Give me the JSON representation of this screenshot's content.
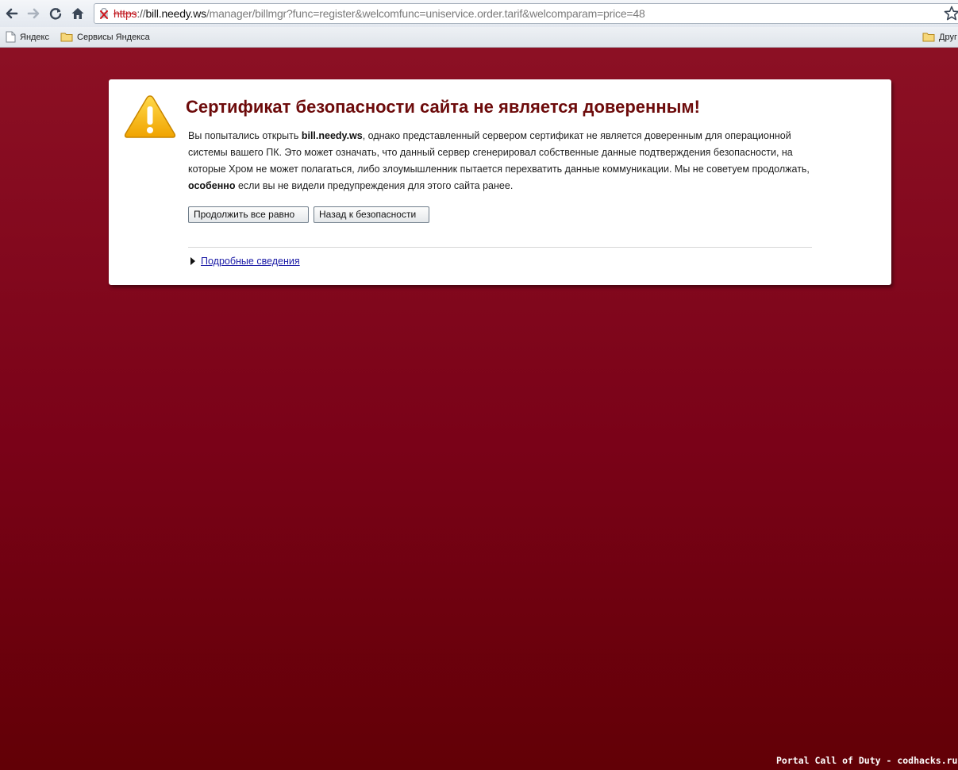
{
  "browser": {
    "url": {
      "scheme": "https",
      "separator": "://",
      "host": "bill.needy.ws",
      "path": "/manager/billmgr?func=register&welcomfunc=uniservice.order.tarif&welcomparam=price=48"
    },
    "bookmarks": [
      {
        "label": "Яндекс",
        "icon": "page-icon"
      },
      {
        "label": "Сервисы Яндекса",
        "icon": "folder-icon"
      },
      {
        "label": "Друг",
        "icon": "folder-icon"
      }
    ]
  },
  "warning": {
    "title": "Сертификат безопасности сайта не является доверенным!",
    "body": {
      "part1": "Вы попытались открыть ",
      "host": "bill.needy.ws",
      "part2": ", однако представленный сервером сертификат не является доверенным для операционной системы вашего ПК. Это может означать, что данный сервер сгенерировал собственные данные подтверждения безопасности, на которые Хром не может полагаться, либо злоумышленник пытается перехватить данные коммуникации. Мы не советуем продолжать, ",
      "emphasis": "особенно",
      "part3": " если вы не видели предупреждения для этого сайта ранее."
    },
    "proceed_label": "Продолжить все равно",
    "back_label": "Назад к безопасности",
    "details_label": "Подробные сведения"
  },
  "watermark": "Portal Call of Duty - codhacks.ru",
  "colors": {
    "background_top": "#8c1024",
    "background_bottom": "#620006",
    "title": "#6d0b0b",
    "link": "#1a1aa6",
    "warning_icon": "#f5b800"
  }
}
